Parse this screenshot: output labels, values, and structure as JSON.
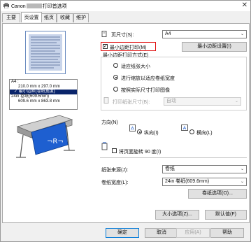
{
  "window": {
    "title_prefix": "Canon",
    "title_suffix": "打印首选项",
    "close_glyph": "✕"
  },
  "tabs": [
    "主要",
    "页设置",
    "纸页",
    "收藏",
    "维护"
  ],
  "preview": {
    "info_line1": "A4 :",
    "info_line2": "210.0 mm x 297.0 mm",
    "info_line3": "✓ 最小边距(卷纸宽度)",
    "info_line4": "24in 卷纸(609.6mm)",
    "info_line5": "609.6 mm x 863.8 mm"
  },
  "page_size": {
    "label": "页尺寸(S):",
    "value": "A4"
  },
  "borderless": {
    "label": "最小边距打印(M)",
    "checked": true,
    "settings_button": "最小边距设置(I)"
  },
  "method": {
    "title": "最小边距打印方式(E)",
    "options": [
      "适应纸张大小",
      "进行缩放以适应卷纸宽度",
      "按照实际尺寸打印图像"
    ],
    "selected": 1,
    "print_size_label": "打印纸张尺寸(B):",
    "print_size_value": "自动"
  },
  "orientation": {
    "title": "方向(N)",
    "portrait": "纵向(I)",
    "landscape": "横向(L)",
    "selected": "portrait",
    "rotate_label": "将页面旋转 90 度(I)"
  },
  "paper_source": {
    "label": "纸张来源(J):",
    "value": "卷纸"
  },
  "roll_width": {
    "label": "卷纸宽度(L):",
    "value": "24in 卷纸(609.6mm)",
    "options_button": "卷纸选项(O)..."
  },
  "footer_buttons": {
    "custom_size": "大小选项(Z)...",
    "defaults": "默认值(F)"
  },
  "dialog_buttons": {
    "ok": "确定",
    "cancel": "取消",
    "apply": "应用(A)",
    "help": "帮助"
  },
  "colors": {
    "highlight_red": "#e01010",
    "selected_blue": "#0a246a",
    "accent_blue": "#1e5fd0"
  }
}
